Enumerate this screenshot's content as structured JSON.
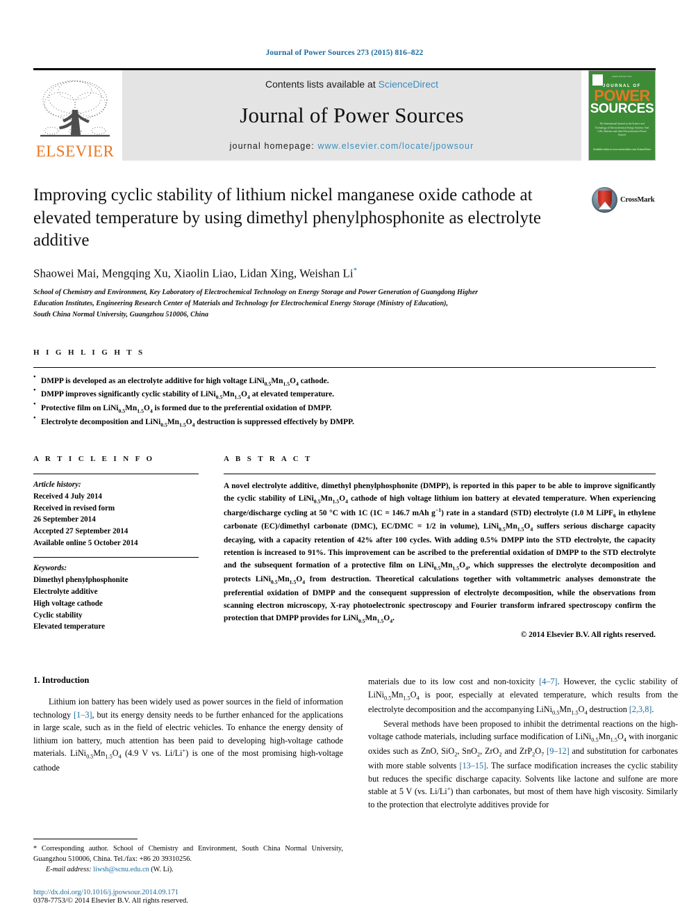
{
  "running_head": "Journal of Power Sources 273 (2015) 816–822",
  "masthead": {
    "publisher_logo_label": "ELSEVIER",
    "contents_prefix": "Contents lists available at ",
    "contents_link": "ScienceDirect",
    "journal_title": "Journal of Power Sources",
    "homepage_prefix": "journal homepage: ",
    "homepage_url": "www.elsevier.com/locate/jpowsour",
    "cover": {
      "top_line": "ISSN 0378-7753",
      "journal_of": "JOURNAL OF",
      "power": "POWER",
      "sources": "SOURCES",
      "blurb": "The International Journal on the Science and Technology of Electrochemical Energy Systems: Fuel Cells, Batteries and other Electrochemical Power Sources",
      "foot": "Available online at www.sciencedirect.com\nScienceDirect"
    }
  },
  "article": {
    "title": "Improving cyclic stability of lithium nickel manganese oxide cathode at elevated temperature by using dimethyl phenylphosphonite as electrolyte additive",
    "crossmark_label": "CrossMark",
    "authors": "Shaowei Mai, Mengqing Xu, Xiaolin Liao, Lidan Xing, Weishan Li",
    "author_marker": "*",
    "affiliation_lines": [
      "School of Chemistry and Environment, Key Laboratory of Electrochemical Technology on Energy Storage and Power Generation of Guangdong Higher",
      "Education Institutes, Engineering Research Center of Materials and Technology for Electrochemical Energy Storage (Ministry of Education),",
      "South China Normal University, Guangzhou 510006, China"
    ]
  },
  "highlights": {
    "heading": "H I G H L I G H T S",
    "items": [
      "DMPP is developed as an electrolyte additive for high voltage LiNi<sub>0.5</sub>Mn<sub>1.5</sub>O<sub>4</sub> cathode.",
      "DMPP improves significantly cyclic stability of LiNi<sub>0.5</sub>Mn<sub>1.5</sub>O<sub>4</sub> at elevated temperature.",
      "Protective film on LiNi<sub>0.5</sub>Mn<sub>1.5</sub>O<sub>4</sub> is formed due to the preferential oxidation of DMPP.",
      "Electrolyte decomposition and LiNi<sub>0.5</sub>Mn<sub>1.5</sub>O<sub>4</sub> destruction is suppressed effectively by DMPP."
    ]
  },
  "article_info": {
    "heading": "A R T I C L E  I N F O",
    "history_label": "Article history:",
    "history": [
      "Received 4 July 2014",
      "Received in revised form",
      "26 September 2014",
      "Accepted 27 September 2014",
      "Available online 5 October 2014"
    ],
    "keywords_label": "Keywords:",
    "keywords": [
      "Dimethyl phenylphosphonite",
      "Electrolyte additive",
      "High voltage cathode",
      "Cyclic stability",
      "Elevated temperature"
    ]
  },
  "abstract": {
    "heading": "A B S T R A C T",
    "text": "A novel electrolyte additive, dimethyl phenylphosphonite (DMPP), is reported in this paper to be able to improve significantly the cyclic stability of LiNi<sub>0.5</sub>Mn<sub>1.5</sub>O<sub>4</sub> cathode of high voltage lithium ion battery at elevated temperature. When experiencing charge/discharge cycling at 50 &deg;C with 1C (1C = 146.7 mAh g<sup>&minus;1</sup>) rate in a standard (STD) electrolyte (1.0 M LiPF<sub>6</sub> in ethylene carbonate (EC)/dimethyl carbonate (DMC), EC/DMC = 1/2 in volume), LiNi<sub>0.5</sub>Mn<sub>1.5</sub>O<sub>4</sub> suffers serious discharge capacity decaying, with a capacity retention of 42% after 100 cycles. With adding 0.5% DMPP into the STD electrolyte, the capacity retention is increased to 91%. This improvement can be ascribed to the preferential oxidation of DMPP to the STD electrolyte and the subsequent formation of a protective film on LiNi<sub>0.5</sub>Mn<sub>1.5</sub>O<sub>4</sub>, which suppresses the electrolyte decomposition and protects LiNi<sub>0.5</sub>Mn<sub>1.5</sub>O<sub>4</sub> from destruction. Theoretical calculations together with voltammetric analyses demonstrate the preferential oxidation of DMPP and the consequent suppression of electrolyte decomposition, while the observations from scanning electron microscopy, X-ray photoelectronic spectroscopy and Fourier transform infrared spectroscopy confirm the protection that DMPP provides for LiNi<sub>0.5</sub>Mn<sub>1.5</sub>O<sub>4</sub>.",
    "copyright": "&copy; 2014 Elsevier B.V. All rights reserved."
  },
  "body": {
    "section_number_title": "1.  Introduction",
    "left_paragraph_1": "Lithium ion battery has been widely used as power sources in the field of information technology <span class=\"ref\">[1&ndash;3]</span>, but its energy density needs to be further enhanced for the applications in large scale, such as in the field of electric vehicles. To enhance the energy density of lithium ion battery, much attention has been paid to developing high-voltage cathode materials. LiNi<sub>0.5</sub>Mn<sub>1.5</sub>O<sub>4</sub> (4.9 V vs. Li/Li<sup>+</sup>) is one of the most promising high-voltage cathode",
    "right_paragraph_1": "materials due to its low cost and non-toxicity <span class=\"ref\">[4&ndash;7]</span>. However, the cyclic stability of LiNi<sub>0.5</sub>Mn<sub>1.5</sub>O<sub>4</sub> is poor, especially at elevated temperature, which results from the electrolyte decomposition and the accompanying LiNi<sub>0.5</sub>Mn<sub>1.5</sub>O<sub>4</sub> destruction <span class=\"ref\">[2,3,8]</span>.",
    "right_paragraph_2": "Several methods have been proposed to inhibit the detrimental reactions on the high-voltage cathode materials, including surface modification of LiNi<sub>0.5</sub>Mn<sub>1.5</sub>O<sub>4</sub> with inorganic oxides such as ZnO, SiO<sub>2</sub>, SnO<sub>2</sub>, ZrO<sub>2</sub> and ZrP<sub>2</sub>O<sub>7</sub> <span class=\"ref\">[9&ndash;12]</span> and substitution for carbonates with more stable solvents <span class=\"ref\">[13&ndash;15]</span>. The surface modification increases the cyclic stability but reduces the specific discharge capacity. Solvents like lactone and sulfone are more stable at 5 V (vs. Li/Li<sup>+</sup>) than carbonates, but most of them have high viscosity. Similarly to the protection that electrolyte additives provide for"
  },
  "footnotes": {
    "corresponding": "* Corresponding author. School of Chemistry and Environment, South China Normal University, Guangzhou 510006, China. Tel./fax: +86 20 39310256.",
    "email_label": "E-mail address:",
    "email": "liwsh@scnu.edu.cn",
    "email_suffix": "(W. Li).",
    "doi": "http://dx.doi.org/10.1016/j.jpowsour.2014.09.171",
    "issn": "0378-7753/&copy; 2014 Elsevier B.V. All rights reserved."
  },
  "colors": {
    "link_blue": "#1b6a9c",
    "sd_blue": "#3b8dbd",
    "elsevier_orange": "#E87722",
    "cover_green": "#3d8b37"
  }
}
